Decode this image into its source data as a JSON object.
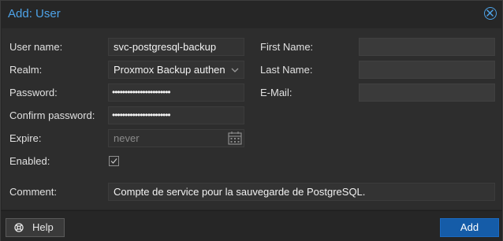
{
  "dialog": {
    "title": "Add: User",
    "accent_color": "#4ea3e8",
    "close_icon": "close-circle-icon"
  },
  "form": {
    "username": {
      "label": "User name:",
      "value": "svc-postgresql-backup"
    },
    "realm": {
      "label": "Realm:",
      "value": "Proxmox Backup authen",
      "icon": "chevron-down-icon"
    },
    "password": {
      "label": "Password:",
      "value": "•••••••••••••••••••••••"
    },
    "confirm_password": {
      "label": "Confirm password:",
      "value": "•••••••••••••••••••••••"
    },
    "expire": {
      "label": "Expire:",
      "placeholder": "never",
      "icon": "calendar-icon"
    },
    "enabled": {
      "label": "Enabled:",
      "checked": true
    },
    "first_name": {
      "label": "First Name:",
      "value": ""
    },
    "last_name": {
      "label": "Last Name:",
      "value": ""
    },
    "email": {
      "label": "E-Mail:",
      "value": ""
    },
    "comment": {
      "label": "Comment:",
      "value": "Compte de service pour la sauvegarde de PostgreSQL."
    }
  },
  "footer": {
    "help_label": "Help",
    "help_icon": "help-circle-icon",
    "add_label": "Add",
    "add_color": "#155ca8"
  }
}
